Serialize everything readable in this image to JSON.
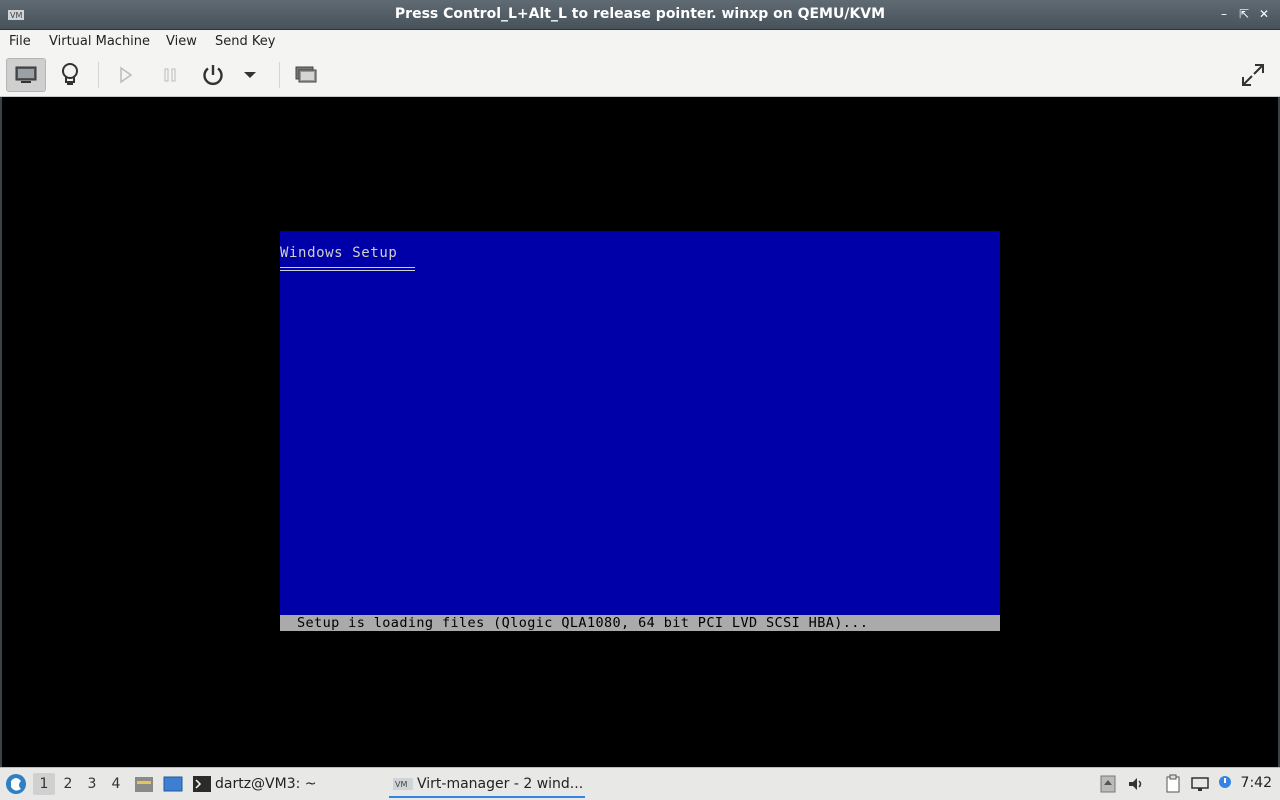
{
  "window": {
    "title": "Press Control_L+Alt_L to release pointer. winxp on QEMU/KVM",
    "app_icon": "vm-icon",
    "controls": [
      "minimize-icon",
      "restore-icon",
      "close-icon"
    ]
  },
  "menubar": {
    "items": [
      "File",
      "Virtual Machine",
      "View",
      "Send Key"
    ]
  },
  "toolbar": {
    "buttons": [
      "console-icon",
      "lightbulb-icon",
      "play-icon",
      "pause-icon",
      "power-icon",
      "dropdown-arrow-icon",
      "snapshots-icon",
      "fullscreen-icon"
    ]
  },
  "guest": {
    "setup_title": "Windows Setup",
    "status": "Setup is loading files (Qlogic QLA1080, 64 bit PCI LVD SCSI HBA)...",
    "colors": {
      "background": "#0000a8",
      "status_bar": "#aaaaaa"
    }
  },
  "taskbar": {
    "workspaces": [
      "1",
      "2",
      "3",
      "4"
    ],
    "active_workspace": "1",
    "tasks": [
      {
        "label": "dartz@VM3: ~",
        "icon": "terminal-icon"
      },
      {
        "label": "Virt-manager - 2 wind...",
        "icon": "vm-icon"
      }
    ],
    "clock": "7:42"
  }
}
